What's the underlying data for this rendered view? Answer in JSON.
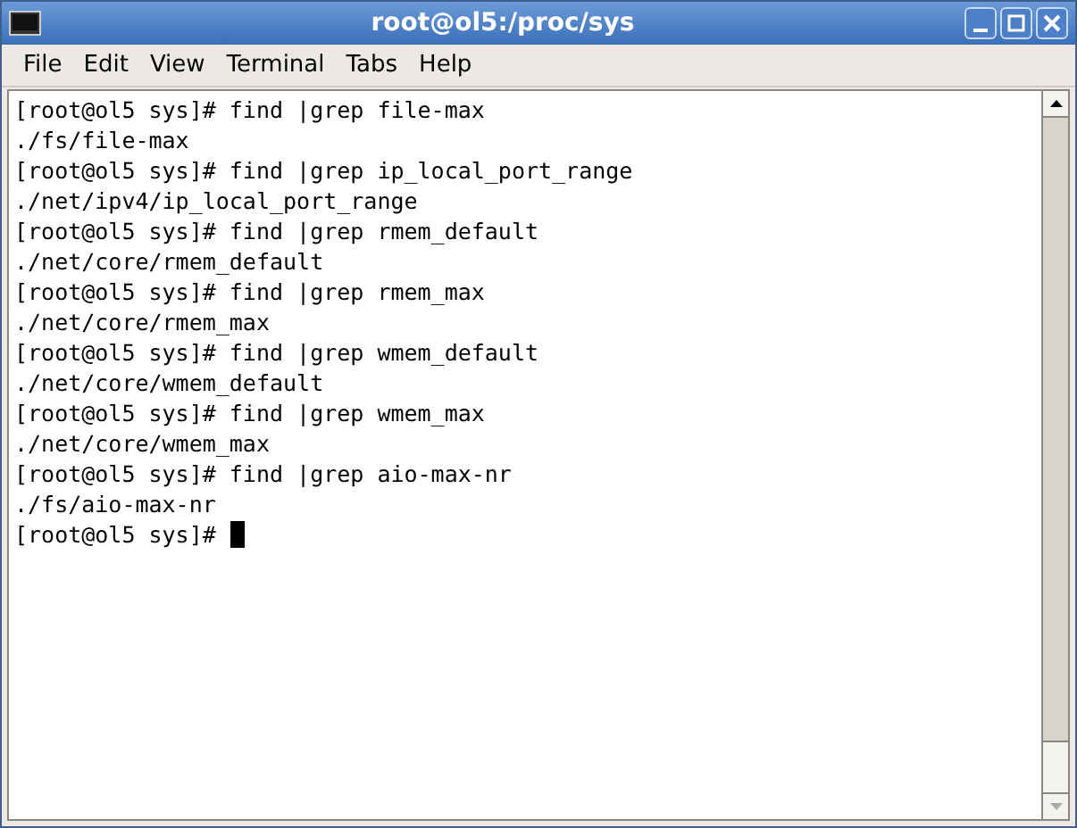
{
  "window": {
    "title": "root@ol5:/proc/sys"
  },
  "menu": [
    "File",
    "Edit",
    "View",
    "Terminal",
    "Tabs",
    "Help"
  ],
  "terminal": {
    "lines": [
      "[root@ol5 sys]# find |grep file-max",
      "./fs/file-max",
      "[root@ol5 sys]# find |grep ip_local_port_range",
      "./net/ipv4/ip_local_port_range",
      "[root@ol5 sys]# find |grep rmem_default",
      "./net/core/rmem_default",
      "[root@ol5 sys]# find |grep rmem_max",
      "./net/core/rmem_max",
      "[root@ol5 sys]# find |grep wmem_default",
      "./net/core/wmem_default",
      "[root@ol5 sys]# find |grep wmem_max",
      "./net/core/wmem_max",
      "[root@ol5 sys]# find |grep aio-max-nr",
      "./fs/aio-max-nr"
    ],
    "prompt": "[root@ol5 sys]#"
  }
}
